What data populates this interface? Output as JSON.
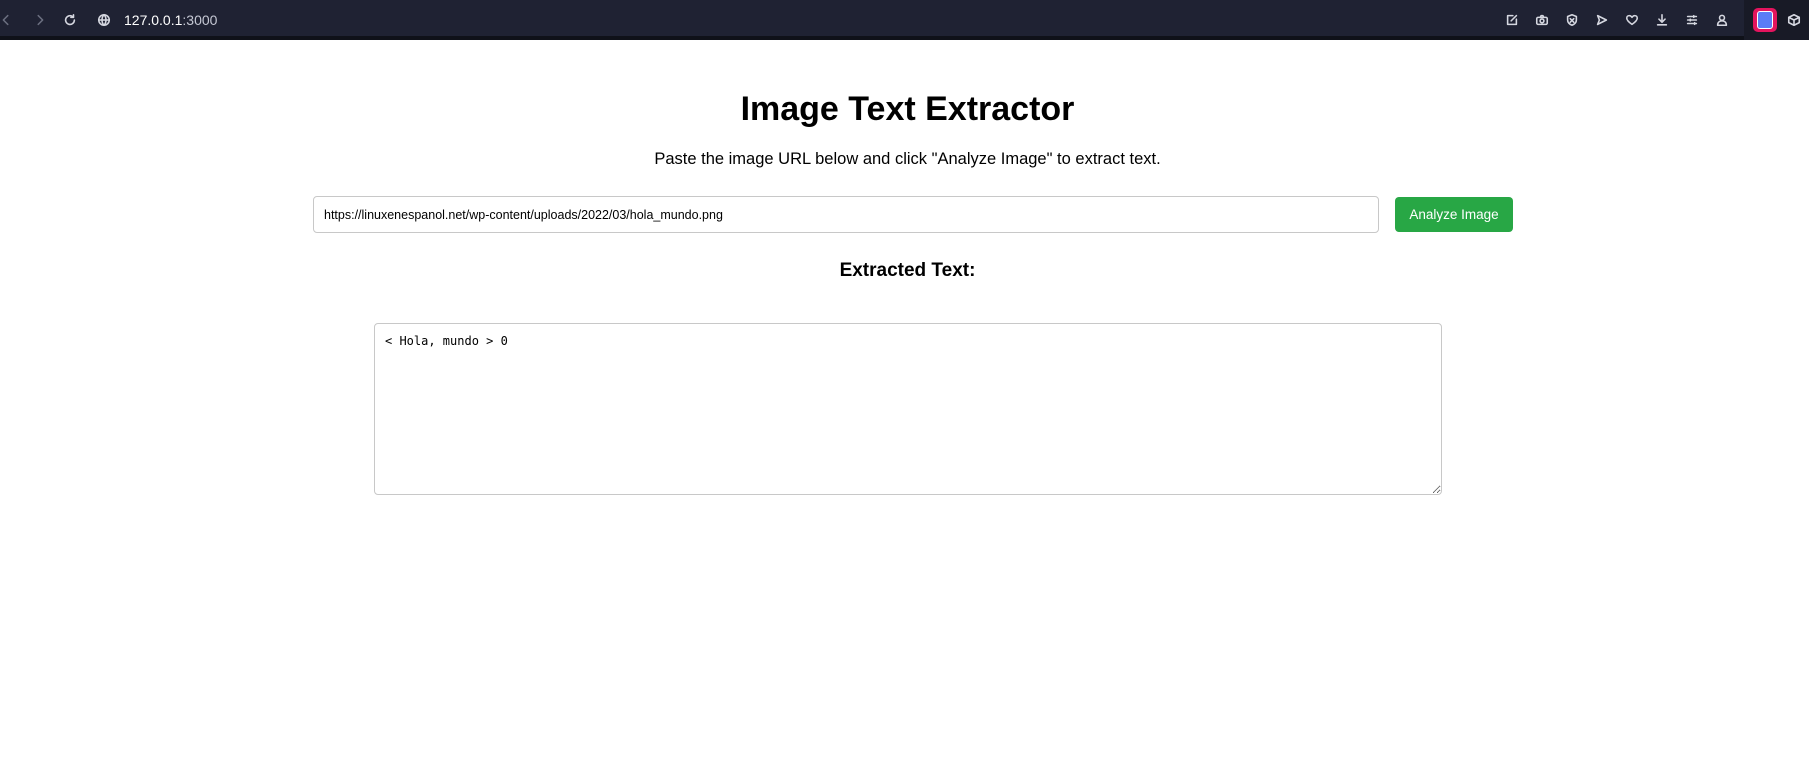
{
  "browser": {
    "url_host": "127.0.0.1",
    "url_port": ":3000",
    "icons": [
      "back-icon",
      "forward-icon",
      "reload-icon",
      "globe-icon",
      "edit-icon",
      "camera-icon",
      "shield-icon",
      "send-icon",
      "heart-icon",
      "download-icon",
      "menu-icon",
      "profile-icon",
      "extension-icon",
      "box-icon"
    ]
  },
  "page": {
    "title": "Image Text Extractor",
    "subtitle": "Paste the image URL below and click \"Analyze Image\" to extract text.",
    "url_input_value": "https://linuxenespanol.net/wp-content/uploads/2022/03/hola_mundo.png",
    "analyze_button_label": "Analyze Image",
    "extracted_heading": "Extracted Text:",
    "extracted_text": "< Hola, mundo > 0"
  },
  "colors": {
    "toolbar_bg": "#1f2233",
    "button_green": "#28a745",
    "extension_badge": "#e3145e"
  }
}
